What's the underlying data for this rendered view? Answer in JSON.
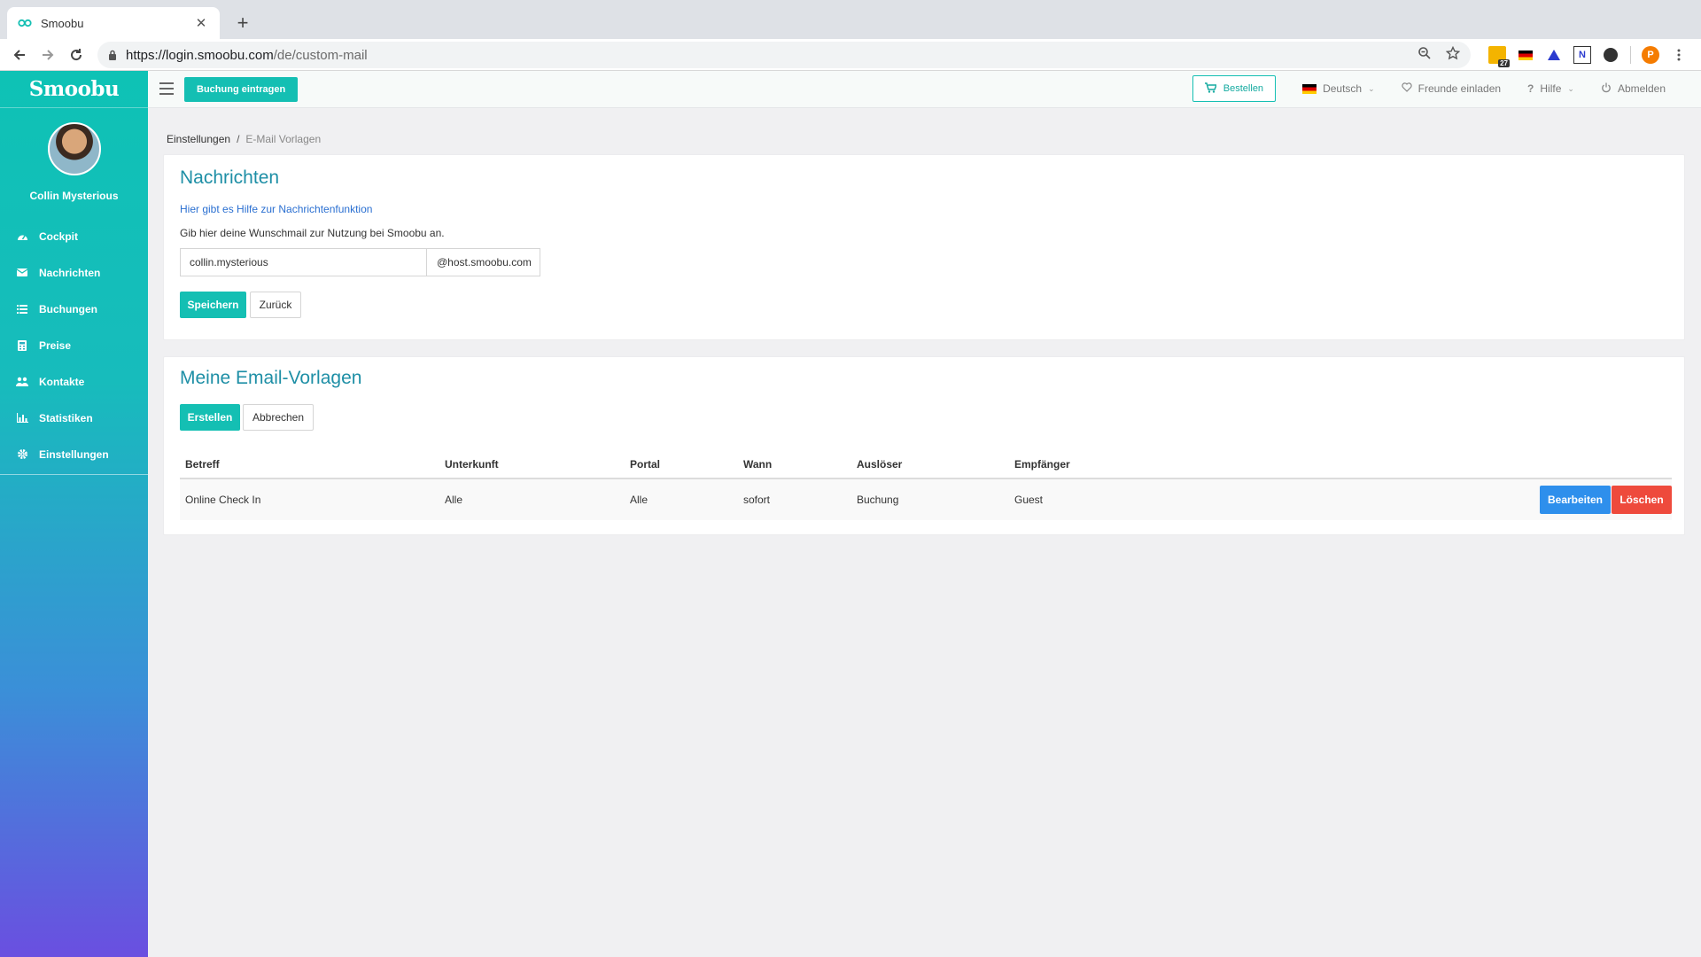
{
  "browser": {
    "tab_title": "Smoobu",
    "url_host": "https://login.smoobu.com",
    "url_path": "/de/custom-mail",
    "calendar_badge": "27",
    "profile_initial": "P"
  },
  "sidebar": {
    "logo": "Smoobu",
    "user_name": "Collin Mysterious",
    "items": [
      {
        "label": "Cockpit",
        "icon": "dashboard-icon"
      },
      {
        "label": "Nachrichten",
        "icon": "envelope-icon"
      },
      {
        "label": "Buchungen",
        "icon": "list-icon"
      },
      {
        "label": "Preise",
        "icon": "calculator-icon"
      },
      {
        "label": "Kontakte",
        "icon": "users-icon"
      },
      {
        "label": "Statistiken",
        "icon": "bar-chart-icon"
      },
      {
        "label": "Einstellungen",
        "icon": "gear-icon"
      }
    ]
  },
  "appbar": {
    "book_button": "Buchung eintragen",
    "order_button": "Bestellen",
    "language": "Deutsch",
    "invite": "Freunde einladen",
    "help": "Hilfe",
    "logout": "Abmelden"
  },
  "breadcrumb": {
    "parent": "Einstellungen",
    "separator": "/",
    "current": "E-Mail Vorlagen"
  },
  "messages_card": {
    "title": "Nachrichten",
    "help_link": "Hier gibt es Hilfe zur Nachrichtenfunktion",
    "description": "Gib hier deine Wunschmail zur Nutzung bei Smoobu an.",
    "email_value": "collin.mysterious",
    "email_domain": "@host.smoobu.com",
    "save_button": "Speichern",
    "back_button": "Zurück"
  },
  "templates_card": {
    "title": "Meine Email-Vorlagen",
    "create_button": "Erstellen",
    "cancel_button": "Abbrechen",
    "columns": [
      "Betreff",
      "Unterkunft",
      "Portal",
      "Wann",
      "Auslöser",
      "Empfänger"
    ],
    "rows": [
      {
        "cells": [
          "Online Check In",
          "Alle",
          "Alle",
          "sofort",
          "Buchung",
          "Guest"
        ],
        "edit_button": "Bearbeiten",
        "delete_button": "Löschen"
      }
    ]
  },
  "colors": {
    "accent": "#14bfb3",
    "title": "#1e8fa6",
    "edit": "#2e8fec",
    "delete": "#ee4a3c",
    "link": "#2a6fd1"
  }
}
